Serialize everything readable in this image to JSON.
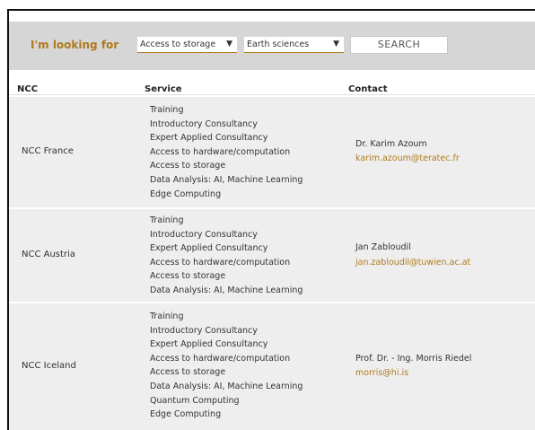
{
  "filter": {
    "label": "I'm looking for",
    "service_select": "Access to storage",
    "domain_select": "Earth sciences",
    "search_label": "SEARCH",
    "arrow": "▼"
  },
  "table": {
    "headers": [
      "NCC",
      "Service",
      "Contact"
    ],
    "rows": [
      {
        "ncc": "NCC France",
        "services": [
          "Training",
          "Introductory Consultancy",
          "Expert Applied Consultancy",
          "Access to hardware/computation",
          "Access to storage",
          "Data Analysis: AI, Machine Learning",
          "Edge Computing"
        ],
        "contact_name": "Dr. Karim Azoum",
        "contact_email": "karim.azoum@teratec.fr"
      },
      {
        "ncc": "NCC Austria",
        "services": [
          "Training",
          "Introductory Consultancy",
          "Expert Applied Consultancy",
          "Access to hardware/computation",
          "Access to storage",
          "Data Analysis: AI, Machine Learning"
        ],
        "contact_name": "Jan Zabloudil",
        "contact_email": "jan.zabloudil@tuwien.ac.at"
      },
      {
        "ncc": "NCC Iceland",
        "services": [
          "Training",
          "Introductory Consultancy",
          "Expert Applied Consultancy",
          "Access to hardware/computation",
          "Access to storage",
          "Data Analysis: AI, Machine Learning",
          "Quantum Computing",
          "Edge Computing"
        ],
        "contact_name": "Prof. Dr. - Ing. Morris Riedel",
        "contact_email": "morris@hi.is"
      }
    ]
  },
  "colors": {
    "accent": "#b07a1f",
    "filter_bg": "#d6d6d6",
    "row_bg": "#eeeeee"
  }
}
